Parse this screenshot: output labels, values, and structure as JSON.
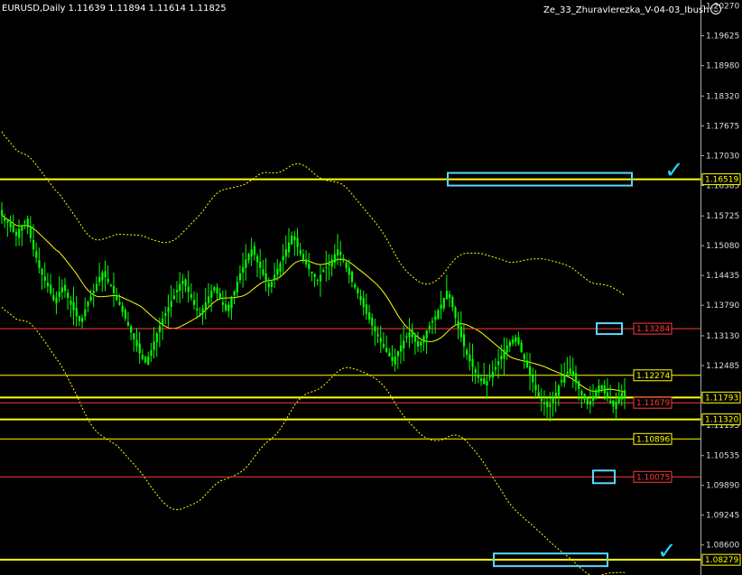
{
  "header": {
    "symbol_info": "EURUSD,Daily  1.11639 1.11894 1.11614 1.11825",
    "indicator_name": "Ze_33_Zhuravlerezka_V-04-03_Ibush"
  },
  "colors": {
    "background": "#000000",
    "bull_candle": "#00ff00",
    "bear_candle": "#00ff00",
    "bands": "#ffff00",
    "support_line": "#ffff00",
    "resistance_line": "#ff3b3b",
    "marker_box": "#5ad8ff",
    "checkmark": "#2ad0ff"
  },
  "icons": {
    "check": "checkmark-icon",
    "smiley": "smiley-icon"
  },
  "chart_data": {
    "type": "candlestick",
    "symbol": "EURUSD",
    "timeframe": "Daily",
    "ylim": [
      1.0795,
      1.204
    ],
    "y_ticks": [
      "1.20270",
      "1.19625",
      "1.18980",
      "1.18320",
      "1.17675",
      "1.17030",
      "1.16385",
      "1.15725",
      "1.15080",
      "1.14435",
      "1.13790",
      "1.13130",
      "1.12485",
      "1.11840",
      "1.11195",
      "1.10535",
      "1.09890",
      "1.09245",
      "1.08600"
    ],
    "price_lines": [
      {
        "price": 1.16519,
        "label": "1.16519",
        "color": "#ffff00",
        "kind": "thick"
      },
      {
        "price": 1.13284,
        "label": "1.13284",
        "color": "#ff3b3b",
        "kind": "thin"
      },
      {
        "price": 1.12274,
        "label": "1.12274",
        "color": "#ffff00",
        "kind": "thin"
      },
      {
        "price": 1.11793,
        "label": "1.11793",
        "color": "#ffff00",
        "kind": "thick"
      },
      {
        "price": 1.11679,
        "label": "1.11679",
        "color": "#ff3b3b",
        "kind": "thin"
      },
      {
        "price": 1.1132,
        "label": "1.11320",
        "color": "#ffff00",
        "kind": "thick"
      },
      {
        "price": 1.10896,
        "label": "1.10896",
        "color": "#ffff00",
        "kind": "thin"
      },
      {
        "price": 1.10075,
        "label": "1.10075",
        "color": "#ff3b3b",
        "kind": "thin"
      },
      {
        "price": 1.08279,
        "label": "1.08279",
        "color": "#ffff00",
        "kind": "thick"
      }
    ],
    "close_series": [
      1.1575,
      1.1562,
      1.1558,
      1.1548,
      1.1538,
      1.153,
      1.1545,
      1.1552,
      1.156,
      1.1548,
      1.1525,
      1.15,
      1.1482,
      1.146,
      1.1445,
      1.1432,
      1.142,
      1.1405,
      1.139,
      1.1395,
      1.1408,
      1.1418,
      1.141,
      1.1395,
      1.138,
      1.1368,
      1.1355,
      1.1345,
      1.1352,
      1.137,
      1.1388,
      1.1398,
      1.141,
      1.1425,
      1.144,
      1.145,
      1.144,
      1.143,
      1.142,
      1.1405,
      1.139,
      1.138,
      1.1365,
      1.135,
      1.1335,
      1.132,
      1.1305,
      1.129,
      1.1275,
      1.1262,
      1.1255,
      1.1268,
      1.1282,
      1.13,
      1.1318,
      1.1335,
      1.135,
      1.1362,
      1.1375,
      1.1388,
      1.14,
      1.1412,
      1.1425,
      1.1432,
      1.142,
      1.1408,
      1.1395,
      1.138,
      1.1368,
      1.136,
      1.1372,
      1.1385,
      1.1398,
      1.141,
      1.1418,
      1.1405,
      1.1392,
      1.138,
      1.1368,
      1.138,
      1.1395,
      1.141,
      1.143,
      1.1448,
      1.1462,
      1.1478,
      1.149,
      1.15,
      1.1488,
      1.1472,
      1.146,
      1.1445,
      1.143,
      1.1418,
      1.143,
      1.1445,
      1.1458,
      1.147,
      1.1485,
      1.15,
      1.1515,
      1.153,
      1.152,
      1.1505,
      1.149,
      1.1478,
      1.1468,
      1.1458,
      1.1448,
      1.144,
      1.1432,
      1.1445,
      1.1455,
      1.1462,
      1.147,
      1.1478,
      1.149,
      1.15,
      1.1488,
      1.1475,
      1.146,
      1.1445,
      1.143,
      1.1418,
      1.1405,
      1.139,
      1.1375,
      1.136,
      1.1348,
      1.1335,
      1.1322,
      1.1312,
      1.13,
      1.1288,
      1.1278,
      1.1268,
      1.1258,
      1.1268,
      1.128,
      1.1292,
      1.1302,
      1.1312,
      1.132,
      1.131,
      1.13,
      1.129,
      1.13,
      1.1312,
      1.1325,
      1.1335,
      1.1345,
      1.1355,
      1.1368,
      1.138,
      1.1395,
      1.141,
      1.1395,
      1.1375,
      1.1352,
      1.133,
      1.131,
      1.129,
      1.1272,
      1.1258,
      1.1245,
      1.1232,
      1.1222,
      1.1215,
      1.1208,
      1.1215,
      1.1225,
      1.1235,
      1.1245,
      1.1258,
      1.127,
      1.1282,
      1.1292,
      1.13,
      1.1305,
      1.131,
      1.1295,
      1.1278,
      1.1262,
      1.1245,
      1.1228,
      1.1212,
      1.1195,
      1.1182,
      1.1172,
      1.1165,
      1.1158,
      1.1165,
      1.1178,
      1.119,
      1.1205,
      1.1218,
      1.1228,
      1.1235,
      1.1242,
      1.1228,
      1.1212,
      1.1198,
      1.1185,
      1.1175,
      1.1165,
      1.1172,
      1.1182,
      1.1195,
      1.1205,
      1.1198,
      1.1188,
      1.1178,
      1.1168,
      1.116,
      1.117,
      1.118,
      1.119,
      1.1182
    ]
  }
}
